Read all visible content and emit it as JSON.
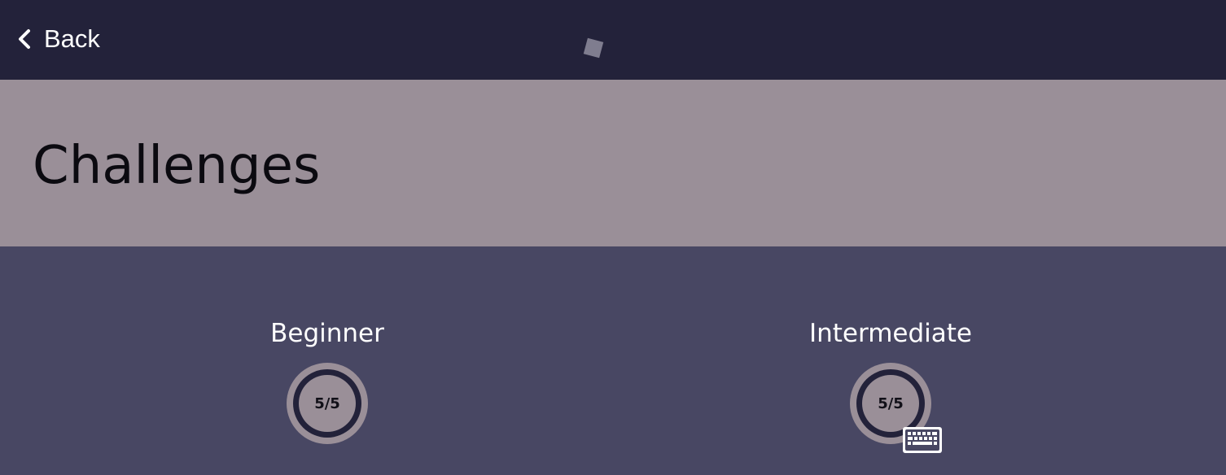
{
  "nav": {
    "back_label": "Back"
  },
  "header": {
    "title": "Challenges"
  },
  "levels": [
    {
      "name": "Beginner",
      "progress": "5/5",
      "completed": 5,
      "total": 5
    },
    {
      "name": "Intermediate",
      "progress": "5/5",
      "completed": 5,
      "total": 5,
      "icon": "keyboard-icon"
    }
  ],
  "colors": {
    "topbar": "#23223a",
    "header_band": "#9a8f98",
    "content": "#484763",
    "ring_track": "#23223a"
  }
}
